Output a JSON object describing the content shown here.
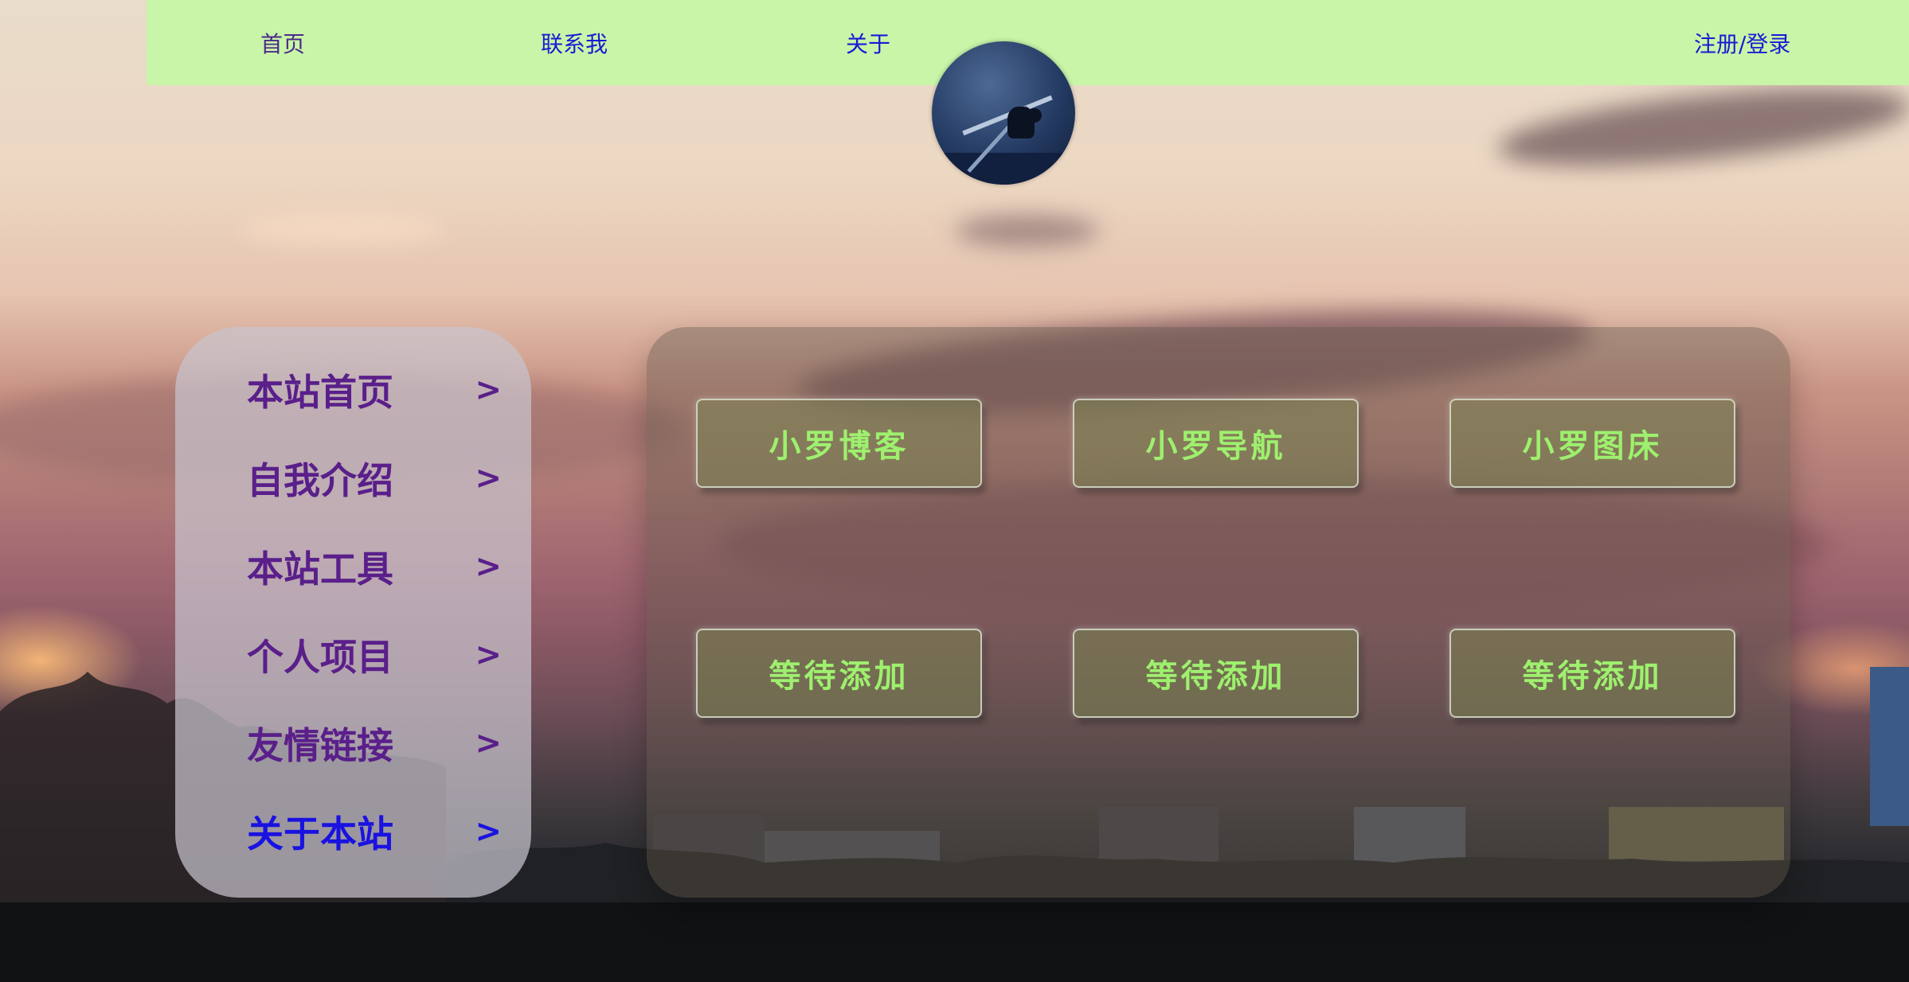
{
  "nav": {
    "home": "首页",
    "contact": "联系我",
    "about": "关于",
    "login": "注册/登录"
  },
  "sidebar": {
    "items": [
      {
        "label": "本站首页",
        "arrow": ">"
      },
      {
        "label": "自我介绍",
        "arrow": ">"
      },
      {
        "label": "本站工具",
        "arrow": ">"
      },
      {
        "label": "个人项目",
        "arrow": ">"
      },
      {
        "label": "友情链接",
        "arrow": ">"
      },
      {
        "label": "关于本站",
        "arrow": ">"
      }
    ],
    "active_index": 5
  },
  "cards": [
    {
      "label": "小罗博客"
    },
    {
      "label": "小罗导航"
    },
    {
      "label": "小罗图床"
    },
    {
      "label": "等待添加"
    },
    {
      "label": "等待添加"
    },
    {
      "label": "等待添加"
    }
  ],
  "colors": {
    "nav_bg": "#c8f5a8",
    "nav_link": "#1a1ad6",
    "sidebar_text": "#5a1f8a",
    "sidebar_active": "#1a12e0",
    "card_text": "#9ef06e"
  },
  "avatar": {
    "icon": "profile-photo"
  }
}
